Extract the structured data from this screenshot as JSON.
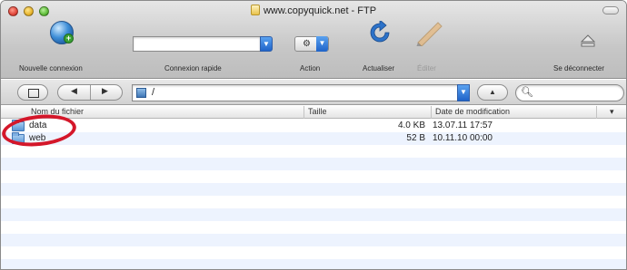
{
  "window": {
    "title": "www.copyquick.net - FTP"
  },
  "toolbar": {
    "new_connection_label": "Nouvelle connexion",
    "quick_connect_label": "Connexion rapide",
    "quick_connect_value": "",
    "action_label": "Action",
    "refresh_label": "Actualiser",
    "edit_label": "Éditer",
    "disconnect_label": "Se déconnecter"
  },
  "pathbar": {
    "path": "/",
    "search_placeholder": ""
  },
  "columns": {
    "name": "Nom du fichier",
    "size": "Taille",
    "modified": "Date de modification"
  },
  "files": [
    {
      "name": "data",
      "size": "4.0 KB",
      "modified": "13.07.11 17:57"
    },
    {
      "name": "web",
      "size": "52 B",
      "modified": "10.11.10 00:00"
    }
  ],
  "colors": {
    "highlight": "#d4172a",
    "accent": "#1f63c8",
    "row_alt": "#edf3fe"
  }
}
